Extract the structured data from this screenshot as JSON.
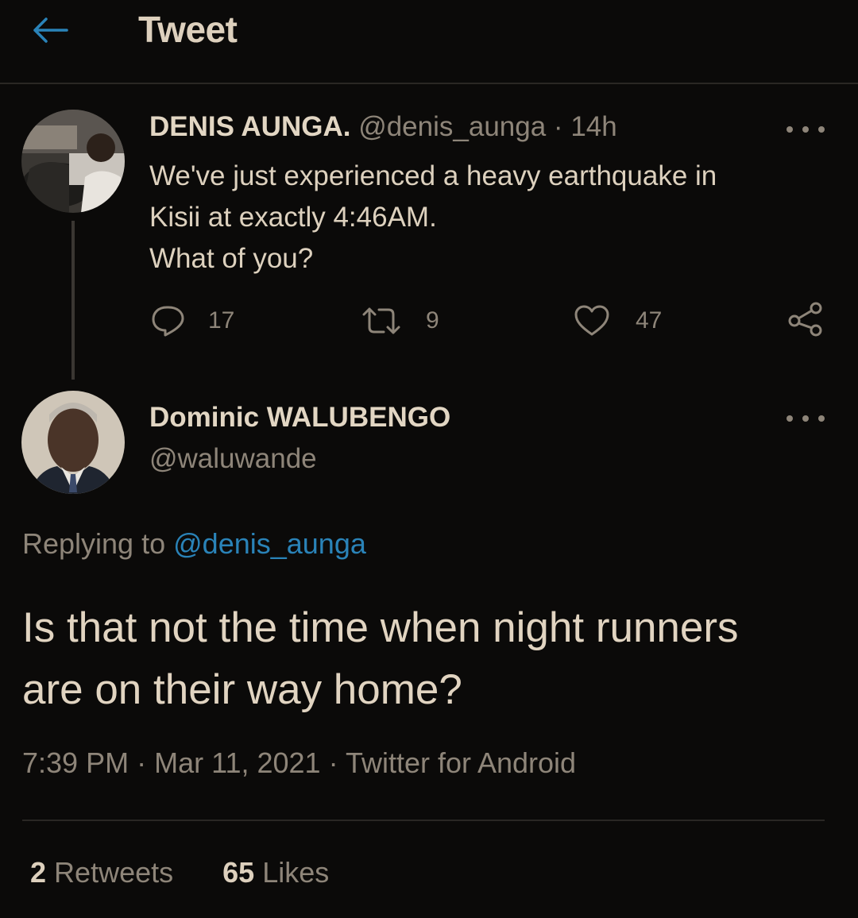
{
  "header": {
    "title": "Tweet",
    "back_icon": "arrow-left-icon",
    "accent_color": "#2a83b8"
  },
  "parent_tweet": {
    "display_name": "DENIS AUNGA.",
    "handle": "@denis_aunga",
    "separator": "·",
    "time": "14h",
    "text_lines": [
      "We've just experienced a heavy earthquake in",
      "Kisii at exactly 4:46AM.",
      "What of you?"
    ],
    "actions": {
      "reply_count": "17",
      "retweet_count": "9",
      "like_count": "47"
    },
    "icons": [
      "reply-icon",
      "retweet-icon",
      "like-icon",
      "share-icon",
      "more-icon"
    ]
  },
  "focused_tweet": {
    "display_name": "Dominic WALUBENGO",
    "handle": "@waluwande",
    "replying_prefix": "Replying to",
    "replying_handle": "@denis_aunga",
    "text_lines": [
      "Is that not the time when night runners",
      "are on their way home?"
    ],
    "time": "7:39 PM",
    "date": "Mar 11, 2021",
    "source": "Twitter for Android",
    "separator": "·",
    "retweets_count": "2",
    "retweets_label": "Retweets",
    "likes_count": "65",
    "likes_label": "Likes"
  }
}
